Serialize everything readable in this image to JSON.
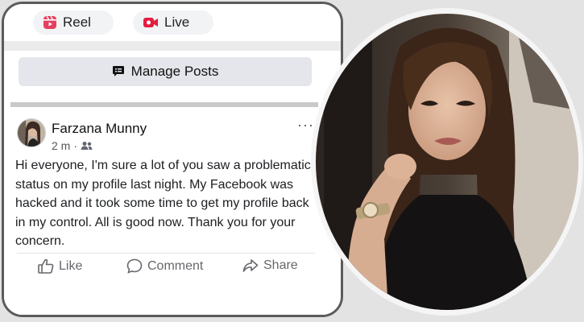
{
  "top_bar": {
    "reel_label": "Reel",
    "live_label": "Live",
    "reel_icon": "reel-icon",
    "live_icon": "video-camera-icon"
  },
  "manage_posts": {
    "label": "Manage Posts",
    "icon": "chat-list-icon"
  },
  "post": {
    "author": "Farzana Munny",
    "time": "2 m",
    "separator": "·",
    "audience_icon": "friends-icon",
    "more_label": "···",
    "text": "Hi everyone, I'm sure a lot of you saw a problematic status on my profile last night. My Facebook was hacked and it took some time to get my profile back in my control. All is good now. Thank you for your concern.",
    "actions": [
      {
        "label": "Like",
        "icon": "thumbs-up-icon"
      },
      {
        "label": "Comment",
        "icon": "comment-icon"
      },
      {
        "label": "Share",
        "icon": "share-icon"
      }
    ]
  },
  "colors": {
    "reel_accent": "#e4405f",
    "live_accent": "#e41e3f",
    "button_bg": "#e4e6eb",
    "action_text": "#65676b",
    "frame_border": "#5b5b5b"
  }
}
